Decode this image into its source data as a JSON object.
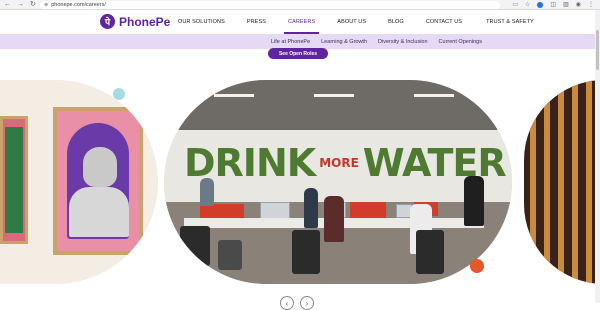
{
  "browser": {
    "url": "phonepe.com/careers/",
    "nav_icons": [
      "back-arrow-icon",
      "forward-arrow-icon",
      "reload-icon"
    ],
    "back_glyph": "←",
    "forward_glyph": "→",
    "reload_glyph": "↻",
    "lock_glyph": "⊕"
  },
  "site": {
    "brand_mark": "पे",
    "brand_name": "PhonePe",
    "brand_color": "#5f259f"
  },
  "main_nav": [
    {
      "label": "OUR SOLUTIONS",
      "active": false
    },
    {
      "label": "PRESS",
      "active": false
    },
    {
      "label": "CAREERS",
      "active": true
    },
    {
      "label": "ABOUT US",
      "active": false
    },
    {
      "label": "BLOG",
      "active": false
    },
    {
      "label": "CONTACT US",
      "active": false
    },
    {
      "label": "TRUST & SAFETY",
      "active": false
    }
  ],
  "sub_nav": [
    {
      "label": "Life at PhonePe"
    },
    {
      "label": "Learning & Growth"
    },
    {
      "label": "Diversity & Inclusion"
    },
    {
      "label": "Current Openings"
    }
  ],
  "cta": {
    "label": "See Open Roles"
  },
  "gallery": {
    "wall_text_1": "DRINK",
    "wall_text_2": "MORE",
    "wall_text_3": "WATER",
    "accent_teal": "#a6dce0",
    "accent_orange": "#e8562c"
  },
  "pager": {
    "prev_glyph": "‹",
    "next_glyph": "›"
  }
}
